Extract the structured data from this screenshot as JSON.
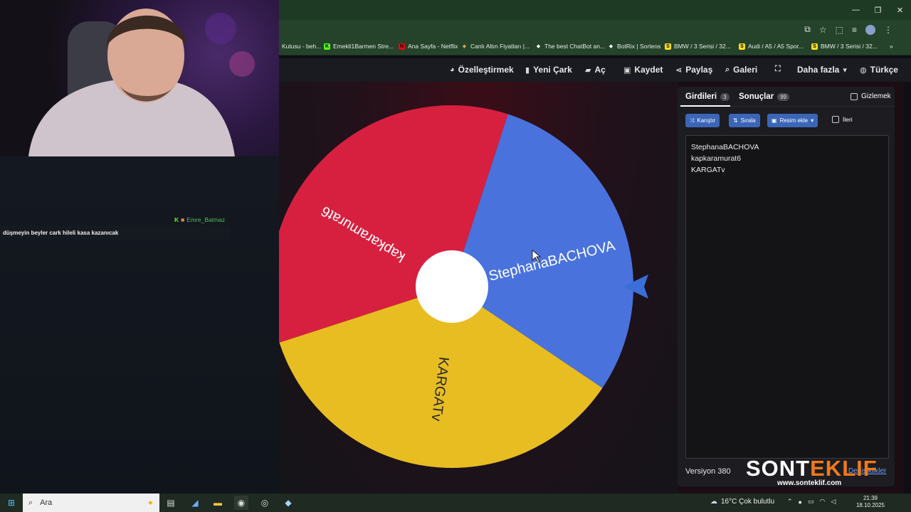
{
  "browser": {
    "bookmarks": [
      {
        "label": "Kutusu - beh...",
        "color": "#9aa0a6",
        "icon": "page-icon"
      },
      {
        "label": "Emekli1Barmen Stre...",
        "color": "#53fc18",
        "icon": "kick-icon"
      },
      {
        "label": "Ana Sayfa - Netflix",
        "color": "#e50914",
        "icon": "netflix-icon"
      },
      {
        "label": "Canlı Altın Fiyatları |...",
        "color": "#c9a94a",
        "icon": "gold-icon"
      },
      {
        "label": "The best ChatBot an...",
        "color": "#ffffff",
        "icon": "diamond-icon"
      },
      {
        "label": "BotRix | Sorteos",
        "color": "#ffffff",
        "icon": "diamond-icon"
      },
      {
        "label": "BMW / 3 Serisi / 32...",
        "color": "#ffde21",
        "icon": "s-icon"
      },
      {
        "label": "Audi / A5 / A5 Spor...",
        "color": "#ffde21",
        "icon": "s-icon"
      },
      {
        "label": "BMW / 3 Serisi / 32...",
        "color": "#ffde21",
        "icon": "s-icon"
      }
    ],
    "more": "»"
  },
  "menu": [
    {
      "label": "Özelleştirmek",
      "icon": "palette-icon"
    },
    {
      "label": "Yeni Çark",
      "icon": "file-icon"
    },
    {
      "label": "Aç",
      "icon": "folder-icon"
    },
    {
      "label": "Kaydet",
      "icon": "save-icon"
    },
    {
      "label": "Paylaş",
      "icon": "share-icon"
    },
    {
      "label": "Galeri",
      "icon": "search-icon"
    },
    {
      "label": "",
      "icon": "fullscreen-icon"
    },
    {
      "label": "Daha fazla",
      "icon": "chevron-down-icon"
    },
    {
      "label": "Türkçe",
      "icon": "globe-icon"
    }
  ],
  "wheel": {
    "segments": [
      {
        "name": "StephanaBACHOVA",
        "color": "#4a72dc"
      },
      {
        "name": "KARGATv",
        "color": "#e8bd22"
      },
      {
        "name": "kapkaramurat6",
        "color": "#d7203f"
      }
    ],
    "pointer_color": "#3a6ed8"
  },
  "panel": {
    "tab_entries": "Girdileri",
    "entries_count": "3",
    "tab_results": "Sonuçlar",
    "results_count": "99",
    "hide_label": "Gizlemek",
    "shuffle_label": "Karıştır",
    "sort_label": "Sırala",
    "add_image_label": "Resim ekle",
    "advanced_label": "İleri",
    "entries": [
      "StephanaBACHOVA",
      "kapkaramurat6",
      "KARGATv"
    ],
    "version": "Versiyon 380",
    "changes_label": "Değişiklikler"
  },
  "chat": {
    "username": "Emre_Batmaz",
    "message": "düşmeyin beyler cark hileli kasa kazanıcak"
  },
  "taskbar": {
    "search_placeholder": "Ara",
    "weather": "16°C  Çok bulutlu",
    "time": "21:39",
    "date": "18.10.2025"
  },
  "watermark": {
    "brand_part1": "SONT",
    "brand_part2": "EKLIF",
    "url": "www.sonteklif.com",
    "color1": "#ffffff",
    "color2": "#f07a18"
  }
}
